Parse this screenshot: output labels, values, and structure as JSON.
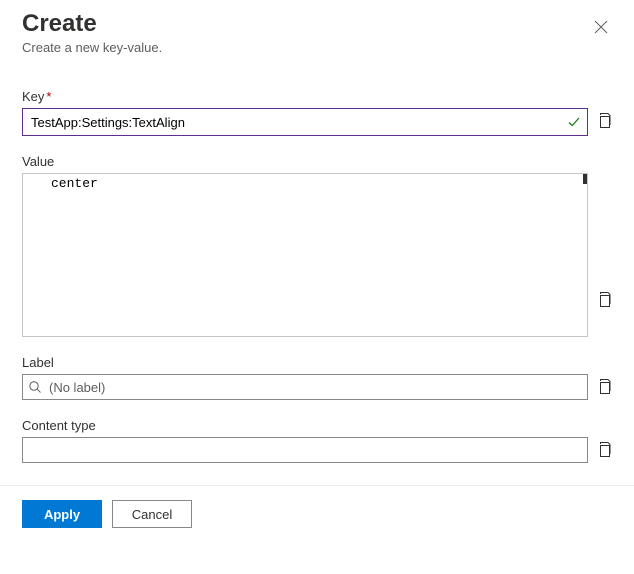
{
  "header": {
    "title": "Create",
    "subtitle": "Create a new key-value."
  },
  "fields": {
    "key": {
      "label": "Key",
      "required_mark": "*",
      "value": "TestApp:Settings:TextAlign"
    },
    "value": {
      "label": "Value",
      "value": "center"
    },
    "labelField": {
      "label": "Label",
      "placeholder": "(No label)",
      "value": ""
    },
    "contentType": {
      "label": "Content type",
      "value": ""
    }
  },
  "footer": {
    "apply": "Apply",
    "cancel": "Cancel"
  }
}
